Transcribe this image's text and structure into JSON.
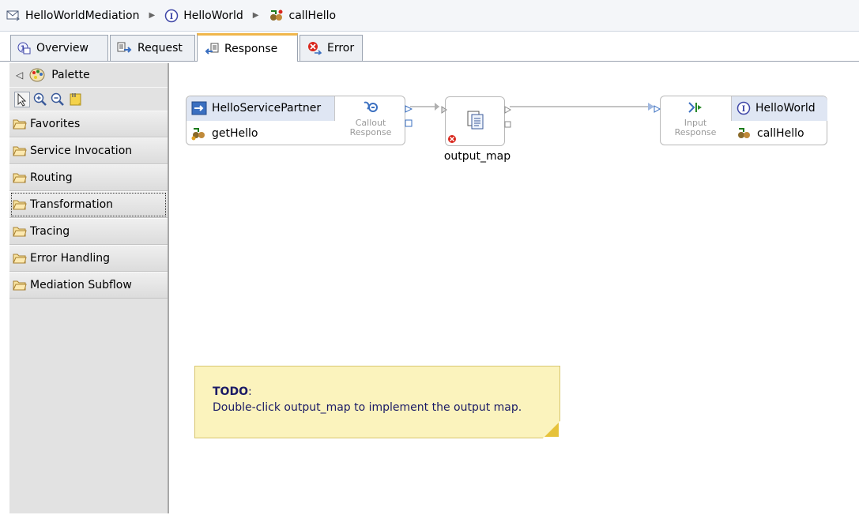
{
  "breadcrumb": {
    "items": [
      {
        "label": "HelloWorldMediation",
        "icon": "mediation-module-icon"
      },
      {
        "label": "HelloWorld",
        "icon": "interface-icon"
      },
      {
        "label": "callHello",
        "icon": "operation-icon"
      }
    ]
  },
  "tabs": [
    {
      "label": "Overview",
      "icon": "overview-icon",
      "active": false
    },
    {
      "label": "Request",
      "icon": "request-icon",
      "active": false
    },
    {
      "label": "Response",
      "icon": "response-icon",
      "active": true
    },
    {
      "label": "Error",
      "icon": "error-icon",
      "active": false
    }
  ],
  "palette": {
    "title": "Palette",
    "drawers": [
      {
        "label": "Favorites"
      },
      {
        "label": "Service Invocation"
      },
      {
        "label": "Routing"
      },
      {
        "label": "Transformation",
        "focused": true
      },
      {
        "label": "Tracing"
      },
      {
        "label": "Error Handling"
      },
      {
        "label": "Mediation Subflow"
      }
    ]
  },
  "canvas": {
    "callout_node": {
      "partner": "HelloServicePartner",
      "operation": "getHello",
      "terminal": "Callout\nResponse"
    },
    "output_map": {
      "label": "output_map"
    },
    "input_node": {
      "terminal": "Input\nResponse",
      "interface": "HelloWorld",
      "operation": "callHello"
    },
    "note": {
      "title": "TODO",
      "colon": ":",
      "body": "Double-click output_map to implement the output map."
    }
  },
  "colors": {
    "accent": "#f0b64a",
    "note": "#fbf3bd",
    "palette_bg": "#e2e2e2",
    "error_red": "#d9261c",
    "interface_blue": "#4048a8"
  }
}
